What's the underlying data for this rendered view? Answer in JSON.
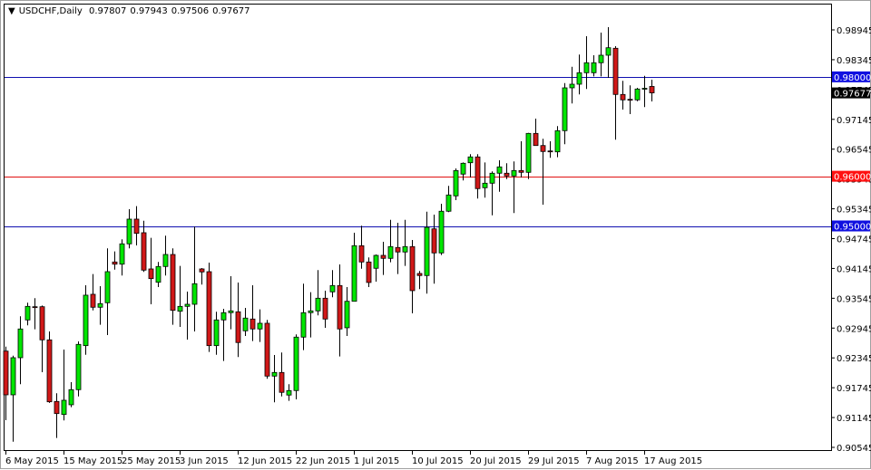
{
  "header": {
    "menu_icon": "triangle-down-icon",
    "symbol_timeframe": "USDCHF,Daily",
    "open": "0.97807",
    "high": "0.97943",
    "low": "0.97506",
    "close": "0.97677"
  },
  "colors": {
    "bull": "#00e600",
    "bear": "#d01818",
    "wick": "#000000",
    "resistance_line": "#1010b0",
    "support_line": "#e01010",
    "current_price_bg": "#000000"
  },
  "chart_data": {
    "type": "candlestick",
    "title": "USDCHF,Daily",
    "ylim": [
      0.90545,
      0.98945
    ],
    "y_ticks": [
      "0.98945",
      "0.98345",
      "0.97745",
      "0.97145",
      "0.96545",
      "0.95945",
      "0.95345",
      "0.94745",
      "0.94145",
      "0.93545",
      "0.92945",
      "0.92345",
      "0.91745",
      "0.91145",
      "0.90545"
    ],
    "x_labels": [
      {
        "bar": 0,
        "text": "6 May 2015"
      },
      {
        "bar": 8,
        "text": "15 May 2015"
      },
      {
        "bar": 16,
        "text": "25 May 2015"
      },
      {
        "bar": 24,
        "text": "3 Jun 2015"
      },
      {
        "bar": 32,
        "text": "12 Jun 2015"
      },
      {
        "bar": 40,
        "text": "22 Jun 2015"
      },
      {
        "bar": 48,
        "text": "1 Jul 2015"
      },
      {
        "bar": 56,
        "text": "10 Jul 2015"
      },
      {
        "bar": 64,
        "text": "20 Jul 2015"
      },
      {
        "bar": 72,
        "text": "29 Jul 2015"
      },
      {
        "bar": 80,
        "text": "7 Aug 2015"
      },
      {
        "bar": 88,
        "text": "17 Aug 2015"
      }
    ],
    "horizontal_lines": [
      {
        "price": 0.98,
        "label": "0.98000",
        "kind": "resistance"
      },
      {
        "price": 0.96,
        "label": "0.96000",
        "kind": "support"
      },
      {
        "price": 0.95,
        "label": "0.95000",
        "kind": "resistance"
      }
    ],
    "current_price": {
      "price": 0.97677,
      "label": "0.97677"
    },
    "ohlc": [
      [
        0.92482,
        0.92573,
        0.91092,
        0.91602
      ],
      [
        0.91602,
        0.92391,
        0.9066,
        0.92349
      ],
      [
        0.92349,
        0.93182,
        0.91815,
        0.92927
      ],
      [
        0.93109,
        0.93455,
        0.93,
        0.93382
      ],
      [
        0.93375,
        0.93546,
        0.9292,
        0.9337
      ],
      [
        0.93375,
        0.934,
        0.92058,
        0.92708
      ],
      [
        0.92708,
        0.92878,
        0.9144,
        0.91462
      ],
      [
        0.91469,
        0.91633,
        0.90733,
        0.91225
      ],
      [
        0.91207,
        0.92513,
        0.91087,
        0.91493
      ],
      [
        0.91402,
        0.91857,
        0.91353,
        0.91706
      ],
      [
        0.91706,
        0.92677,
        0.91571,
        0.92617
      ],
      [
        0.92592,
        0.93807,
        0.92409,
        0.93607
      ],
      [
        0.93625,
        0.94031,
        0.93302,
        0.93364
      ],
      [
        0.93364,
        0.93789,
        0.93011,
        0.93437
      ],
      [
        0.93455,
        0.94548,
        0.92805,
        0.9408
      ],
      [
        0.94275,
        0.94487,
        0.94122,
        0.94231
      ],
      [
        0.94231,
        0.94731,
        0.94002,
        0.9464
      ],
      [
        0.9464,
        0.95337,
        0.94548,
        0.95137
      ],
      [
        0.95137,
        0.95398,
        0.94609,
        0.94851
      ],
      [
        0.94864,
        0.95106,
        0.94075,
        0.94111
      ],
      [
        0.94135,
        0.9476,
        0.93424,
        0.9394
      ],
      [
        0.93867,
        0.94275,
        0.93771,
        0.94184
      ],
      [
        0.94184,
        0.94804,
        0.94002,
        0.94426
      ],
      [
        0.94426,
        0.94548,
        0.93011,
        0.93302
      ],
      [
        0.93284,
        0.94195,
        0.92969,
        0.93382
      ],
      [
        0.93382,
        0.93679,
        0.92714,
        0.93424
      ],
      [
        0.93424,
        0.94986,
        0.92878,
        0.93838
      ],
      [
        0.94135,
        0.94153,
        0.9382,
        0.94075
      ],
      [
        0.9408,
        0.94262,
        0.92464,
        0.92592
      ],
      [
        0.92592,
        0.93273,
        0.92409,
        0.93109
      ],
      [
        0.93109,
        0.93333,
        0.92282,
        0.93255
      ],
      [
        0.93255,
        0.93989,
        0.9292,
        0.93291
      ],
      [
        0.93273,
        0.93862,
        0.92362,
        0.92654
      ],
      [
        0.9289,
        0.93351,
        0.92787,
        0.93146
      ],
      [
        0.93127,
        0.93807,
        0.92683,
        0.92927
      ],
      [
        0.92927,
        0.93321,
        0.92665,
        0.93042
      ],
      [
        0.93042,
        0.93109,
        0.91925,
        0.91979
      ],
      [
        0.91979,
        0.92404,
        0.91451,
        0.92052
      ],
      [
        0.92052,
        0.92453,
        0.91571,
        0.91652
      ],
      [
        0.91597,
        0.91815,
        0.9148,
        0.91688
      ],
      [
        0.91688,
        0.92818,
        0.91511,
        0.92763
      ],
      [
        0.92763,
        0.93838,
        0.92501,
        0.93255
      ],
      [
        0.93255,
        0.93667,
        0.92756,
        0.93291
      ],
      [
        0.93291,
        0.94111,
        0.932,
        0.93546
      ],
      [
        0.93546,
        0.93698,
        0.92951,
        0.93127
      ],
      [
        0.93674,
        0.94111,
        0.93565,
        0.93801
      ],
      [
        0.93801,
        0.94226,
        0.92373,
        0.92927
      ],
      [
        0.92951,
        0.93771,
        0.92787,
        0.93484
      ],
      [
        0.93484,
        0.94864,
        0.9348,
        0.94603
      ],
      [
        0.94603,
        0.95004,
        0.9414,
        0.94275
      ],
      [
        0.94275,
        0.94366,
        0.93771,
        0.93862
      ],
      [
        0.94148,
        0.94426,
        0.9388,
        0.94408
      ],
      [
        0.94408,
        0.94682,
        0.94013,
        0.94348
      ],
      [
        0.94348,
        0.95124,
        0.94268,
        0.94585
      ],
      [
        0.94567,
        0.95064,
        0.94031,
        0.94476
      ],
      [
        0.94476,
        0.95124,
        0.94195,
        0.94585
      ],
      [
        0.94585,
        0.94718,
        0.93242,
        0.93698
      ],
      [
        0.94044,
        0.94093,
        0.93729,
        0.94002
      ],
      [
        0.94002,
        0.95288,
        0.93638,
        0.94973
      ],
      [
        0.94942,
        0.95228,
        0.93838,
        0.94457
      ],
      [
        0.94457,
        0.95447,
        0.94414,
        0.95296
      ],
      [
        0.95296,
        0.95806,
        0.95278,
        0.95623
      ],
      [
        0.95605,
        0.96157,
        0.9552,
        0.96115
      ],
      [
        0.96043,
        0.96279,
        0.95915,
        0.96261
      ],
      [
        0.96272,
        0.96443,
        0.95975,
        0.96389
      ],
      [
        0.96389,
        0.96443,
        0.95551,
        0.95751
      ],
      [
        0.95769,
        0.96279,
        0.95569,
        0.9586
      ],
      [
        0.9586,
        0.96097,
        0.95215,
        0.96061
      ],
      [
        0.96061,
        0.96321,
        0.95689,
        0.96188
      ],
      [
        0.96061,
        0.96261,
        0.95944,
        0.96006
      ],
      [
        0.96006,
        0.96298,
        0.95259,
        0.96115
      ],
      [
        0.96115,
        0.96704,
        0.95975,
        0.96079
      ],
      [
        0.96079,
        0.96873,
        0.95944,
        0.96862
      ],
      [
        0.96862,
        0.97159,
        0.96618,
        0.96618
      ],
      [
        0.96618,
        0.96753,
        0.95429,
        0.96498
      ],
      [
        0.96509,
        0.96704,
        0.96371,
        0.96505
      ],
      [
        0.96491,
        0.97008,
        0.96382,
        0.96917
      ],
      [
        0.96917,
        0.97875,
        0.96644,
        0.97779
      ],
      [
        0.97779,
        0.98203,
        0.97464,
        0.97852
      ],
      [
        0.97852,
        0.98448,
        0.97646,
        0.98083
      ],
      [
        0.98083,
        0.98817,
        0.97755,
        0.98284
      ],
      [
        0.98083,
        0.98435,
        0.9801,
        0.98284
      ],
      [
        0.98284,
        0.9889,
        0.9801,
        0.98435
      ],
      [
        0.98435,
        0.99,
        0.97979,
        0.98586
      ],
      [
        0.98575,
        0.98617,
        0.96735,
        0.97646
      ],
      [
        0.97646,
        0.97919,
        0.97342,
        0.97537
      ],
      [
        0.97548,
        0.97828,
        0.97251,
        0.97543
      ],
      [
        0.97537,
        0.97779,
        0.97511,
        0.97755
      ],
      [
        0.97767,
        0.98021,
        0.97391,
        0.9777
      ],
      [
        0.97807,
        0.97943,
        0.97506,
        0.97677
      ]
    ]
  }
}
